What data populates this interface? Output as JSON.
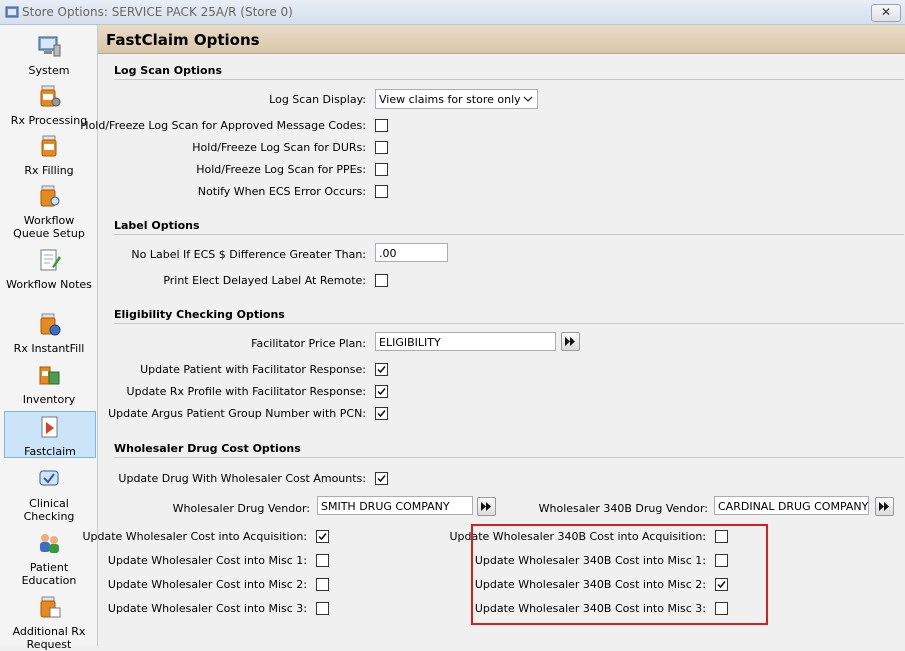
{
  "window": {
    "title": "Store Options: SERVICE PACK 25A/R (Store 0)",
    "close_label": "✕"
  },
  "sidebar": {
    "items": [
      {
        "label": "System",
        "icon": "computer-icon"
      },
      {
        "label": "Rx Processing",
        "icon": "pill-bottle-gear-icon"
      },
      {
        "label": "Rx Filling",
        "icon": "pill-bottle-icon"
      },
      {
        "label": "Workflow Queue Setup",
        "icon": "pill-bottle-search-icon"
      },
      {
        "label": "Workflow Notes",
        "icon": "notepad-icon"
      },
      {
        "label": "Rx InstantFill",
        "icon": "pill-bottle-refresh-icon"
      },
      {
        "label": "Inventory",
        "icon": "inventory-icon"
      },
      {
        "label": "Fastclaim",
        "icon": "fastclaim-icon"
      },
      {
        "label": "Clinical Checking",
        "icon": "clinical-icon"
      },
      {
        "label": "Patient Education",
        "icon": "people-icon"
      },
      {
        "label": "Additional Rx Request",
        "icon": "rx-request-icon"
      }
    ]
  },
  "header": {
    "title": "FastClaim Options"
  },
  "log_scan": {
    "title": "Log Scan Options",
    "display_label": "Log Scan Display:",
    "display_value": "View claims for store only",
    "hold_approved_label": "Hold/Freeze Log Scan for Approved Message Codes:",
    "hold_durs_label": "Hold/Freeze Log Scan for DURs:",
    "hold_ppes_label": "Hold/Freeze Log Scan for PPEs:",
    "notify_ecs_label": "Notify When ECS Error Occurs:"
  },
  "label_options": {
    "title": "Label Options",
    "no_label_label": "No Label If ECS $ Difference Greater Than:",
    "no_label_value": ".00",
    "print_elect_label": "Print Elect Delayed Label At Remote:"
  },
  "eligibility": {
    "title": "Eligibility Checking Options",
    "price_plan_label": "Facilitator Price Plan:",
    "price_plan_value": "ELIGIBILITY",
    "update_patient_label": "Update Patient with Facilitator Response:",
    "update_rx_profile_label": "Update Rx Profile with Facilitator Response:",
    "update_argus_label": "Update Argus Patient Group Number with PCN:"
  },
  "wholesaler": {
    "title": "Wholesaler Drug Cost Options",
    "update_drug_label": "Update Drug With Wholesaler Cost Amounts:",
    "vendor_label": "Wholesaler Drug Vendor:",
    "vendor_value": "SMITH DRUG COMPANY",
    "vendor_340b_label": "Wholesaler 340B Drug Vendor:",
    "vendor_340b_value": "CARDINAL DRUG COMPANY",
    "left": [
      {
        "label": "Update Wholesaler Cost into Acquisition:",
        "checked": true
      },
      {
        "label": "Update Wholesaler Cost into Misc 1:",
        "checked": false
      },
      {
        "label": "Update Wholesaler Cost into Misc 2:",
        "checked": false
      },
      {
        "label": "Update Wholesaler Cost into Misc 3:",
        "checked": false
      }
    ],
    "right": [
      {
        "label": "Update Wholesaler 340B Cost into Acquisition:",
        "checked": false
      },
      {
        "label": "Update Wholesaler 340B Cost into Misc 1:",
        "checked": false
      },
      {
        "label": "Update Wholesaler 340B Cost into Misc 2:",
        "checked": true
      },
      {
        "label": "Update Wholesaler 340B Cost into Misc 3:",
        "checked": false
      }
    ]
  },
  "colors": {
    "highlight": "#d42020",
    "header_bg": "#dccdb3",
    "active_nav": "#cce4f7"
  }
}
